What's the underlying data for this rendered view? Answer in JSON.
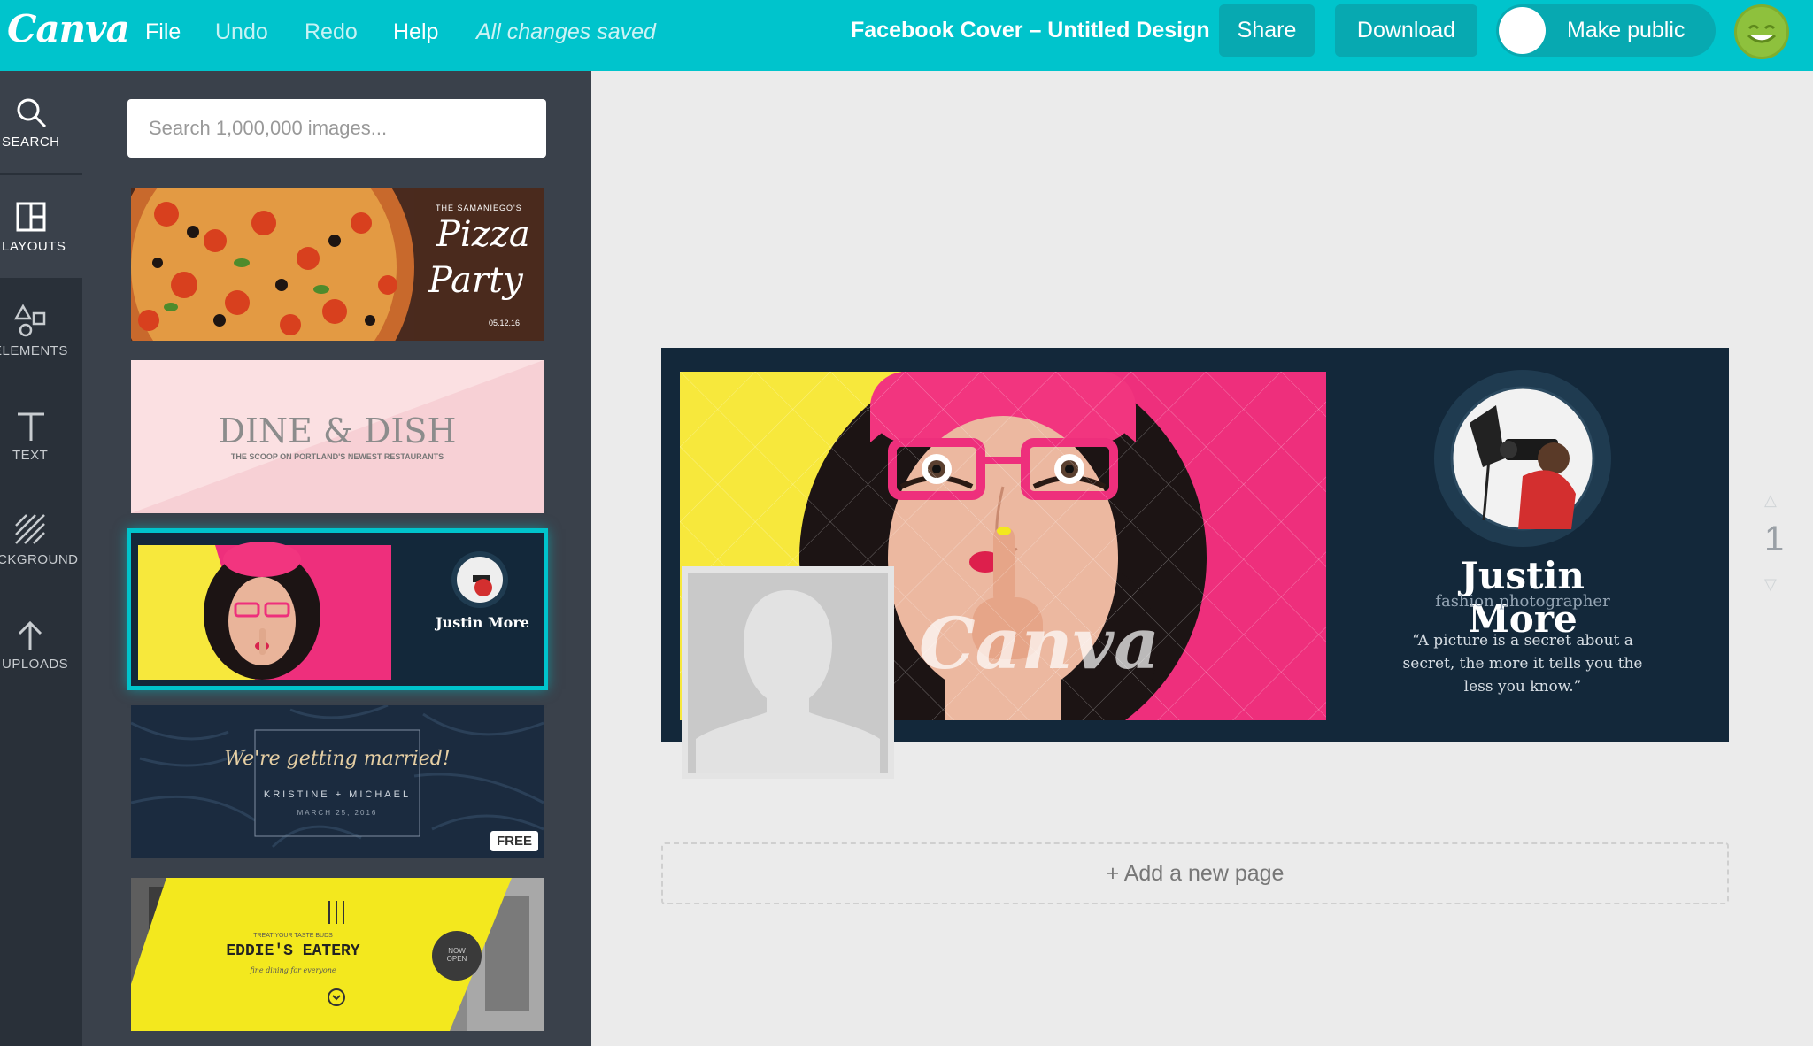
{
  "app": {
    "logo": "Canva"
  },
  "menu": {
    "file": "File",
    "undo": "Undo",
    "redo": "Redo",
    "help": "Help"
  },
  "status": {
    "saved": "All changes saved"
  },
  "document": {
    "title": "Facebook Cover – Untitled Design"
  },
  "actions": {
    "share": "Share",
    "download": "Download",
    "make_public": "Make public"
  },
  "sidebar": {
    "items": [
      {
        "label": "SEARCH",
        "icon": "search-icon"
      },
      {
        "label": "LAYOUTS",
        "icon": "layouts-icon"
      },
      {
        "label": "ELEMENTS",
        "icon": "elements-icon"
      },
      {
        "label": "TEXT",
        "icon": "text-icon"
      },
      {
        "label": "BACKGROUND",
        "icon": "background-icon"
      },
      {
        "label": "UPLOADS",
        "icon": "uploads-icon"
      }
    ],
    "active": "LAYOUTS"
  },
  "panel": {
    "search_placeholder": "Search 1,000,000 images...",
    "layouts": [
      {
        "name": "pizza-party",
        "small_title": "THE SAMANIEGO'S",
        "title_line1": "Pizza",
        "title_line2": "Party",
        "date": "05.12.16"
      },
      {
        "name": "dine-dish",
        "title": "DINE & DISH",
        "subtitle": "THE SCOOP ON PORTLAND'S NEWEST RESTAURANTS"
      },
      {
        "name": "justin-more",
        "title": "Justin More"
      },
      {
        "name": "wedding",
        "title": "We're getting married!",
        "names": "KRISTINE + MICHAEL",
        "date": "MARCH 25, 2016",
        "badge": "FREE"
      },
      {
        "name": "eddies-eatery",
        "small_title": "TREAT YOUR TASTE BUDS",
        "title": "EDDIE'S EATERY",
        "tagline": "fine dining for everyone",
        "badge_line1": "NOW",
        "badge_line2": "OPEN"
      }
    ]
  },
  "canvas": {
    "name": "Justin More",
    "role": "fashion photographer",
    "quote": "“A picture is a secret about a secret, the more it tells you the less you know.”",
    "watermark": "Canva",
    "page_number": "1",
    "add_page": "+ Add a new page"
  },
  "colors": {
    "brand": "#00c4cc",
    "rail": "#293039",
    "panel": "#3a414b",
    "navy": "#13283a",
    "pink": "#ee2f7c",
    "yellow": "#f7e83c"
  }
}
